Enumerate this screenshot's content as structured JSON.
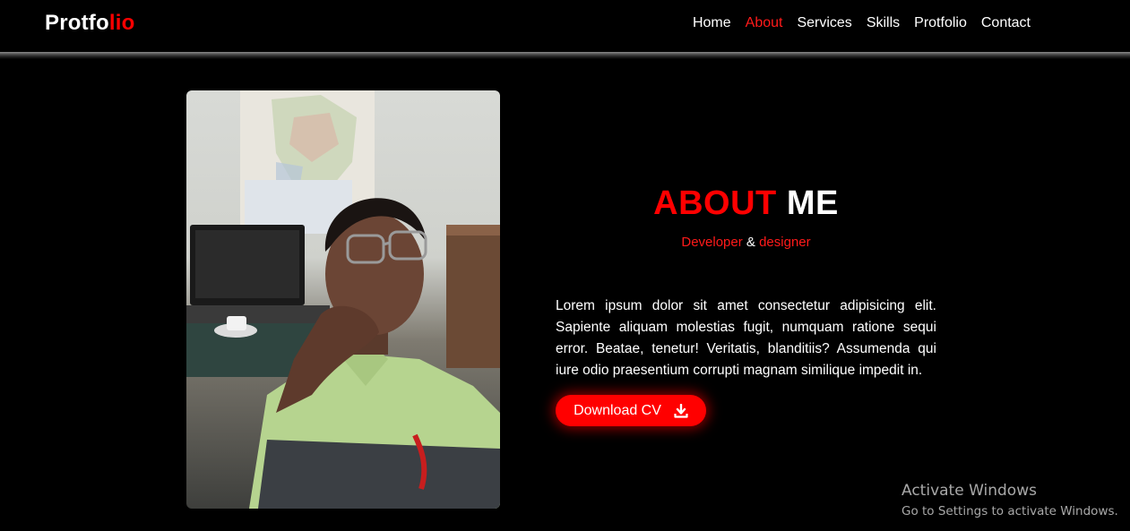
{
  "logo": {
    "part1": "Protfo",
    "part2": "lio"
  },
  "nav": {
    "items": [
      {
        "label": "Home",
        "active": false
      },
      {
        "label": "About",
        "active": true
      },
      {
        "label": "Services",
        "active": false
      },
      {
        "label": "Skills",
        "active": false
      },
      {
        "label": "Protfolio",
        "active": false
      },
      {
        "label": "Contact",
        "active": false
      }
    ]
  },
  "about": {
    "title_red": "ABOUT",
    "title_white": "ME",
    "subtitle_left": "Developer",
    "subtitle_amp": "&",
    "subtitle_right": "designer",
    "description": "Lorem ipsum dolor sit amet consectetur adipisicing elit. Sapiente aliquam molestias fugit, numquam ratione sequi error. Beatae, tenetur! Veritatis, blanditiis? Assumenda qui iure odio praesentium corrupti magnam similique impedit in.",
    "button_label": "Download CV",
    "button_icon": "download-icon"
  },
  "watermark": {
    "line1": "Activate Windows",
    "line2": "Go to Settings to activate Windows."
  },
  "colors": {
    "accent": "#ff0000",
    "background": "#000000",
    "text": "#ffffff"
  }
}
